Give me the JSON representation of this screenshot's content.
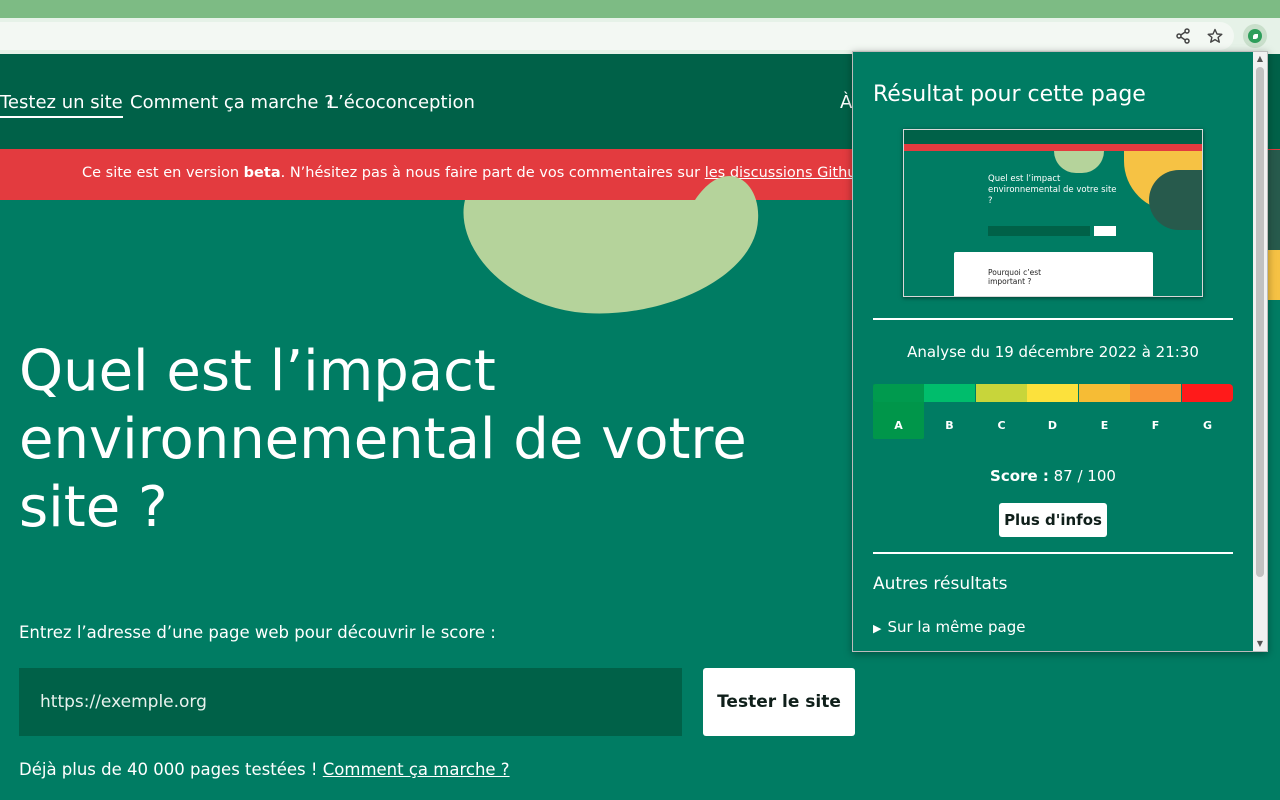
{
  "site": {
    "nav": [
      "Testez un site",
      "Comment ça marche ?",
      "L’écoconception",
      "À"
    ],
    "banner": {
      "prefix": "Ce site est en version ",
      "bold": "beta",
      "middle": ". N’hésitez pas à nous faire part de vos commentaires sur ",
      "link": "les discussions Github"
    },
    "hero": {
      "title": "Quel est l’impact environnemental de votre site ?",
      "label": "Entrez l’adresse d’une page web pour découvrir le score :",
      "input_placeholder": "https://exemple.org",
      "button": "Tester le site",
      "footer_text": "Déjà plus de 40 000 pages testées ! ",
      "footer_link": "Comment ça marche ?"
    }
  },
  "browser": {
    "share_icon": "share-icon",
    "star_icon": "star-icon",
    "extension_icon": "leaf-icon"
  },
  "popup": {
    "title": "Résultat pour cette page",
    "thumbnail": {
      "title": "Quel est l’impact environnemental de votre site ?",
      "card_title": "Pourquoi c’est important ?"
    },
    "analysis_date": "Analyse du 19 décembre 2022 à 21:30",
    "grades": [
      {
        "letter": "A",
        "color": "#009a4e"
      },
      {
        "letter": "B",
        "color": "#00bd6c"
      },
      {
        "letter": "C",
        "color": "#c8d53a"
      },
      {
        "letter": "D",
        "color": "#fce13c"
      },
      {
        "letter": "E",
        "color": "#f6bc35"
      },
      {
        "letter": "F",
        "color": "#f99437"
      },
      {
        "letter": "G",
        "color": "#ff1a1a"
      }
    ],
    "selected_grade": "A",
    "score_label": "Score :",
    "score_value": "87 / 100",
    "more_button": "Plus d'infos",
    "other_results": "Autres résultats",
    "same_page": "Sur la même page"
  },
  "colors": {
    "site_green": "#007c63",
    "nav_dark_green": "#006148",
    "banner_red": "#e33b3f",
    "blob_green": "#b5d39b"
  }
}
